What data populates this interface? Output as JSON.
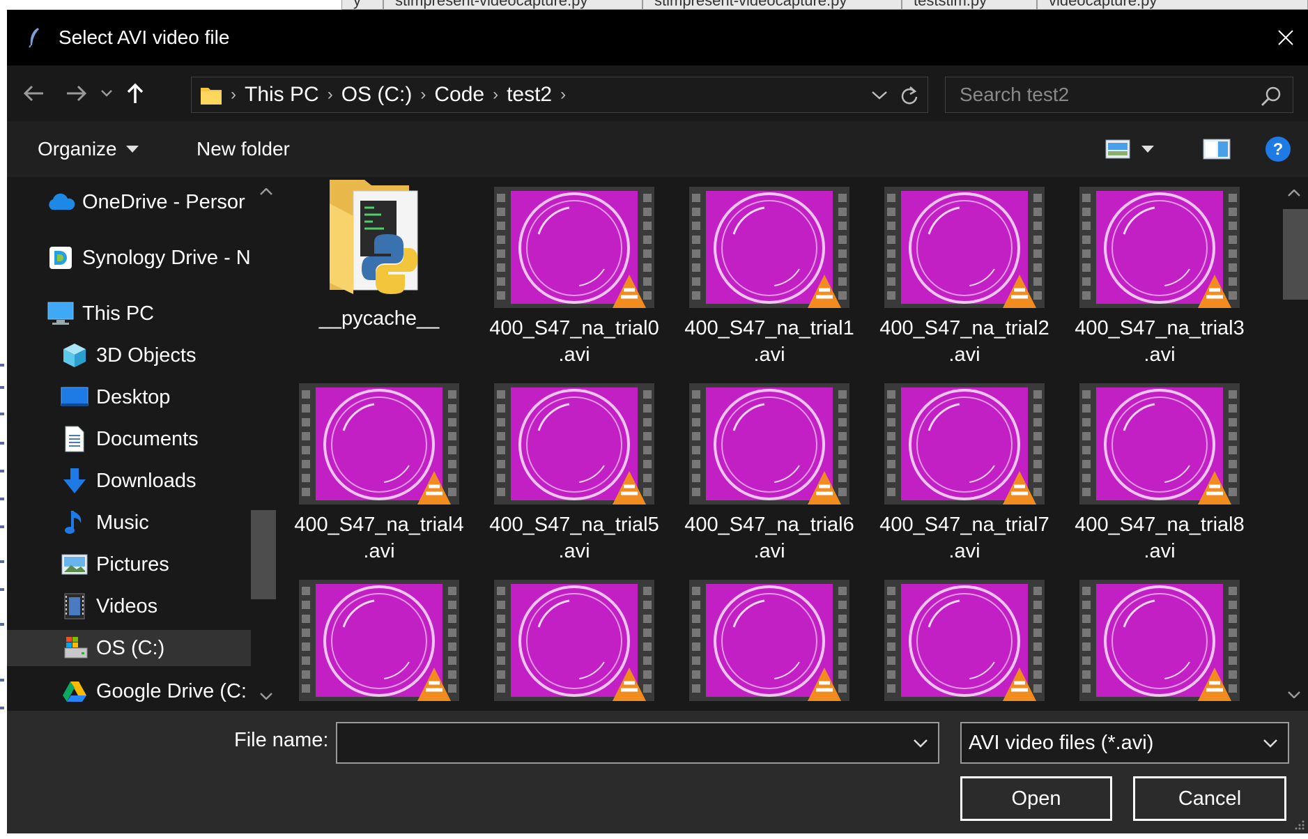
{
  "window": {
    "title": "Select AVI video file"
  },
  "background": {
    "tabs": [
      "y",
      "stimpresent-videocapture.py",
      "stimpresent-videocapture.py",
      "teststim.py",
      "videocapture.py"
    ]
  },
  "address": {
    "breadcrumbs": [
      "This PC",
      "OS (C:)",
      "Code",
      "test2"
    ]
  },
  "search": {
    "placeholder": "Search test2"
  },
  "commands": {
    "organize": "Organize",
    "new_folder": "New folder"
  },
  "sidebar": {
    "items": [
      {
        "label": "OneDrive - Persor",
        "icon": "onedrive-cloud-icon"
      },
      {
        "label": "Synology Drive - N",
        "icon": "synology-drive-icon"
      },
      {
        "label": "This PC",
        "icon": "monitor-icon"
      },
      {
        "label": "3D Objects",
        "icon": "cube-icon"
      },
      {
        "label": "Desktop",
        "icon": "desktop-icon"
      },
      {
        "label": "Documents",
        "icon": "document-icon"
      },
      {
        "label": "Downloads",
        "icon": "download-arrow-icon"
      },
      {
        "label": "Music",
        "icon": "music-note-icon"
      },
      {
        "label": "Pictures",
        "icon": "picture-icon"
      },
      {
        "label": "Videos",
        "icon": "film-icon"
      },
      {
        "label": "OS (C:)",
        "icon": "drive-icon"
      },
      {
        "label": "Google Drive (C:",
        "icon": "google-drive-icon"
      }
    ],
    "selected": "OS (C:)"
  },
  "files": [
    {
      "name": "__pycache__",
      "ext": "",
      "type": "folder"
    },
    {
      "name": "400_S47_na_trial0",
      "ext": ".avi",
      "type": "video"
    },
    {
      "name": "400_S47_na_trial1",
      "ext": ".avi",
      "type": "video"
    },
    {
      "name": "400_S47_na_trial2",
      "ext": ".avi",
      "type": "video"
    },
    {
      "name": "400_S47_na_trial3",
      "ext": ".avi",
      "type": "video"
    },
    {
      "name": "400_S47_na_trial4",
      "ext": ".avi",
      "type": "video"
    },
    {
      "name": "400_S47_na_trial5",
      "ext": ".avi",
      "type": "video"
    },
    {
      "name": "400_S47_na_trial6",
      "ext": ".avi",
      "type": "video"
    },
    {
      "name": "400_S47_na_trial7",
      "ext": ".avi",
      "type": "video"
    },
    {
      "name": "400_S47_na_trial8",
      "ext": ".avi",
      "type": "video"
    },
    {
      "name": "",
      "ext": "",
      "type": "video"
    },
    {
      "name": "",
      "ext": "",
      "type": "video"
    },
    {
      "name": "",
      "ext": "",
      "type": "video"
    },
    {
      "name": "",
      "ext": "",
      "type": "video"
    },
    {
      "name": "",
      "ext": "",
      "type": "video"
    }
  ],
  "footer": {
    "filename_label": "File name:",
    "filename_value": "",
    "filter": "AVI video files (*.avi)",
    "open": "Open",
    "cancel": "Cancel"
  },
  "colors": {
    "accent_help": "#1e7be6",
    "dialog_bg": "#191919",
    "thumb_magenta": "#c020c0"
  }
}
